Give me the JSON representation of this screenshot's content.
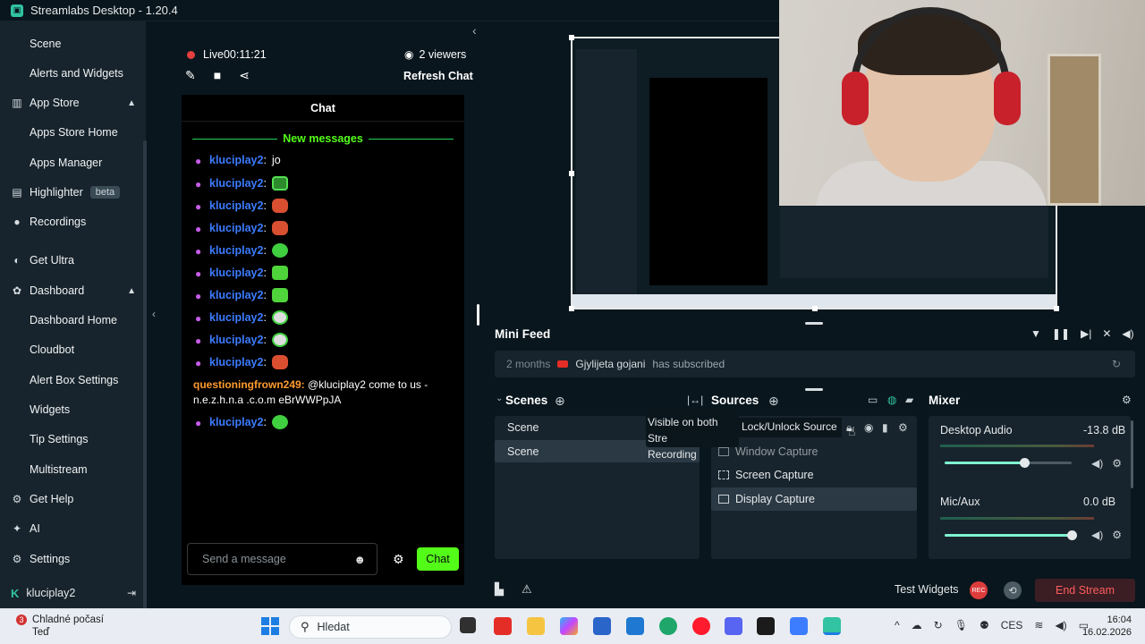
{
  "window": {
    "title": "Streamlabs Desktop - 1.20.4"
  },
  "sidebar": {
    "items": [
      {
        "label": "Scene"
      },
      {
        "label": "Alerts and Widgets"
      },
      {
        "label": "App Store"
      },
      {
        "label": "Apps Store Home"
      },
      {
        "label": "Apps Manager"
      },
      {
        "label": "Highlighter"
      },
      {
        "label": "Recordings"
      },
      {
        "label": "Get Ultra"
      },
      {
        "label": "Dashboard"
      },
      {
        "label": "Dashboard Home"
      },
      {
        "label": "Cloudbot"
      },
      {
        "label": "Alert Box Settings"
      },
      {
        "label": "Widgets"
      },
      {
        "label": "Tip Settings"
      },
      {
        "label": "Multistream"
      },
      {
        "label": "Get Help"
      },
      {
        "label": "AI"
      },
      {
        "label": "Settings"
      }
    ],
    "highlighter_badge": "beta",
    "user": "kluciplay2"
  },
  "stream": {
    "live_label": "Live",
    "live_time": "00:11:21",
    "viewers": "2 viewers",
    "refresh_chat": "Refresh Chat"
  },
  "chat": {
    "header": "Chat",
    "new_messages": "New messages",
    "messages": [
      {
        "user": "kluciplay2",
        "text": "jo"
      },
      {
        "user": "kluciplay2",
        "text": ""
      },
      {
        "user": "kluciplay2",
        "text": ""
      },
      {
        "user": "kluciplay2",
        "text": ""
      },
      {
        "user": "kluciplay2",
        "text": ""
      },
      {
        "user": "kluciplay2",
        "text": ""
      },
      {
        "user": "kluciplay2",
        "text": ""
      },
      {
        "user": "kluciplay2",
        "text": ""
      },
      {
        "user": "kluciplay2",
        "text": ""
      },
      {
        "user": "kluciplay2",
        "text": ""
      }
    ],
    "long_message": {
      "user": "questioningfrown249:",
      "text": " @kluciplay2 come to us - n.e.z.h.n.a .c.o.m eBrWWPpJA"
    },
    "last_message": {
      "user": "kluciplay2",
      "text": ""
    },
    "input_placeholder": "Send a message",
    "send_label": "Chat"
  },
  "mini_feed": {
    "title": "Mini Feed",
    "event": {
      "time": "2 months",
      "name": "Gjylijeta gojani",
      "action": "has subscribed"
    }
  },
  "scenes": {
    "title": "Scenes",
    "items": [
      "Scene",
      "Scene"
    ]
  },
  "sources": {
    "title": "Sources",
    "tooltip": "Visible on both Stream and Recording",
    "tooltip_visible": "Visible on both Stre",
    "tooltip_line2": "Recording",
    "lock_tooltip": "Lock/Unlock Source",
    "items": [
      "Window Capture",
      "Screen Capture",
      "Display Capture"
    ]
  },
  "mixer": {
    "title": "Mixer",
    "channels": [
      {
        "name": "Desktop Audio",
        "db": "-13.8 dB",
        "level": 0.63
      },
      {
        "name": "Mic/Aux",
        "db": "0.0 dB",
        "level": 1.0
      }
    ]
  },
  "footer": {
    "test_widgets": "Test Widgets",
    "rec": "REC",
    "end_stream": "End Stream"
  },
  "taskbar": {
    "weather": "Chladné počasí",
    "weather_sub": "Teď",
    "weather_badge": "3",
    "search": "Hledat",
    "lang": "CES",
    "time": "16:04",
    "date": "16.02.2026"
  },
  "colors": {
    "accent": "#31c3a2",
    "live_red": "#e53f3f",
    "chat_green": "#53fc18",
    "user_blue": "#3c7cff",
    "user_orange": "#ff9b2f"
  }
}
